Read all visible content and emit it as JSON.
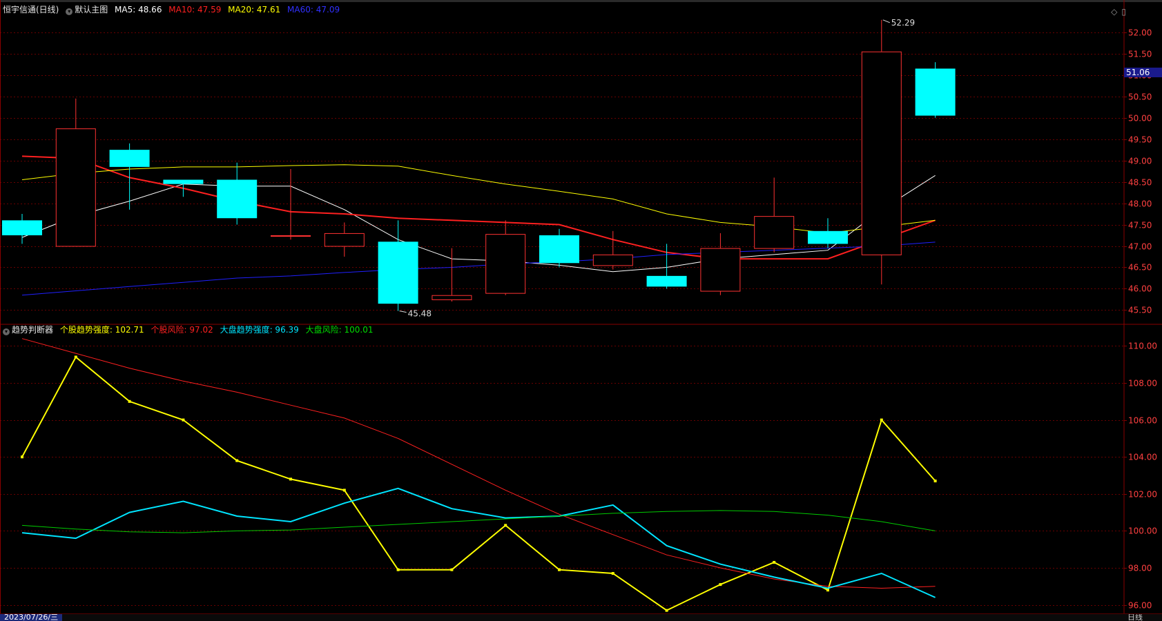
{
  "main_legend": {
    "title": "恒宇信通(日线)",
    "template": "默认主图",
    "ma5": "MA5: 48.66",
    "ma10": "MA10: 47.59",
    "ma20": "MA20: 47.61",
    "ma60": "MA60: 47.09"
  },
  "sub_legend": {
    "title": "趋势判断器",
    "s1": "个股趋势强度: 102.71",
    "s2": "个股风险: 97.02",
    "s3": "大盘趋势强度: 96.39",
    "s4": "大盘风险: 100.01"
  },
  "status": {
    "date": "2023/07/26/三",
    "period": "日线"
  },
  "toolbar": {
    "icons": [
      "diamond-icon",
      "window-icon"
    ]
  },
  "colors": {
    "up": "#ff3232",
    "down": "#00ffff",
    "ma5": "#ffffff",
    "ma10": "#ff2020",
    "ma20": "#ffff00",
    "ma60": "#2020ff",
    "grid": "#6a0000"
  },
  "chart_data": [
    {
      "type": "candlestick",
      "ylim": [
        45.2,
        52.4
      ],
      "yticks": [
        "45.50",
        "46.00",
        "46.50",
        "47.00",
        "47.50",
        "48.00",
        "48.50",
        "49.00",
        "49.50",
        "50.00",
        "50.50",
        "51.00",
        "51.50",
        "52.00"
      ],
      "last_price_label": "51.06",
      "high_label": "52.29",
      "low_label": "45.48",
      "candles": [
        {
          "o": 47.6,
          "c": 47.25,
          "h": 47.75,
          "l": 47.05
        },
        {
          "o": 47.0,
          "c": 49.75,
          "h": 50.45,
          "l": 47.0
        },
        {
          "o": 49.25,
          "c": 48.85,
          "h": 49.4,
          "l": 47.85
        },
        {
          "o": 48.55,
          "c": 48.45,
          "h": 48.55,
          "l": 48.15
        },
        {
          "o": 48.55,
          "c": 47.65,
          "h": 48.95,
          "l": 47.5
        },
        {
          "o": 47.25,
          "c": 47.25,
          "h": 48.8,
          "l": 47.15
        },
        {
          "o": 47.0,
          "c": 47.3,
          "h": 47.55,
          "l": 46.75
        },
        {
          "o": 47.1,
          "c": 45.65,
          "h": 47.6,
          "l": 45.48
        },
        {
          "o": 45.75,
          "c": 45.85,
          "h": 46.95,
          "l": 45.7
        },
        {
          "o": 45.9,
          "c": 47.28,
          "h": 47.6,
          "l": 45.85
        },
        {
          "o": 47.25,
          "c": 46.6,
          "h": 47.4,
          "l": 46.5
        },
        {
          "o": 46.55,
          "c": 46.8,
          "h": 47.35,
          "l": 46.45
        },
        {
          "o": 46.3,
          "c": 46.05,
          "h": 47.05,
          "l": 46.0
        },
        {
          "o": 45.95,
          "c": 46.95,
          "h": 47.3,
          "l": 45.85
        },
        {
          "o": 46.95,
          "c": 47.7,
          "h": 48.6,
          "l": 46.85
        },
        {
          "o": 47.35,
          "c": 47.05,
          "h": 47.65,
          "l": 46.95
        },
        {
          "o": 46.8,
          "c": 51.55,
          "h": 52.29,
          "l": 46.1
        },
        {
          "o": 51.15,
          "c": 50.05,
          "h": 51.3,
          "l": 50.0
        }
      ],
      "series": [
        {
          "name": "MA5",
          "values": [
            47.2,
            47.7,
            48.05,
            48.45,
            48.4,
            48.4,
            47.85,
            47.15,
            46.7,
            46.65,
            46.55,
            46.4,
            46.5,
            46.7,
            46.8,
            46.9,
            47.85,
            48.65
          ]
        },
        {
          "name": "MA10",
          "values": [
            49.1,
            49.05,
            48.6,
            48.35,
            48.05,
            47.8,
            47.75,
            47.65,
            47.6,
            47.55,
            47.5,
            47.15,
            46.85,
            46.7,
            46.7,
            46.7,
            47.15,
            47.6
          ]
        },
        {
          "name": "MA20",
          "values": [
            48.55,
            48.7,
            48.8,
            48.85,
            48.85,
            48.88,
            48.9,
            48.87,
            48.65,
            48.45,
            48.28,
            48.1,
            47.75,
            47.55,
            47.45,
            47.3,
            47.45,
            47.6
          ]
        },
        {
          "name": "MA60",
          "values": [
            45.85,
            45.95,
            46.05,
            46.15,
            46.25,
            46.3,
            46.38,
            46.45,
            46.5,
            46.58,
            46.63,
            46.7,
            46.8,
            46.85,
            46.9,
            46.95,
            47.0,
            47.09
          ]
        }
      ]
    },
    {
      "type": "line",
      "ylim": [
        95.5,
        110.5
      ],
      "yticks": [
        "96.00",
        "98.00",
        "100.00",
        "102.00",
        "104.00",
        "106.00",
        "108.00",
        "110.00"
      ],
      "series": [
        {
          "name": "个股趋势强度",
          "values": [
            104.0,
            109.4,
            107.0,
            106.0,
            103.8,
            102.8,
            102.2,
            97.9,
            97.9,
            100.3,
            97.9,
            97.7,
            95.7,
            97.1,
            98.3,
            96.8,
            106.0,
            102.7
          ]
        },
        {
          "name": "个股风险",
          "values": [
            110.4,
            109.6,
            108.8,
            108.1,
            107.5,
            106.8,
            106.1,
            105.0,
            103.6,
            102.2,
            100.9,
            99.8,
            98.7,
            98.0,
            97.4,
            97.0,
            96.9,
            97.0
          ]
        },
        {
          "name": "大盘趋势强度",
          "values": [
            99.9,
            99.6,
            101.0,
            101.6,
            100.8,
            100.5,
            101.5,
            102.3,
            101.2,
            100.7,
            100.8,
            101.4,
            99.2,
            98.2,
            97.5,
            96.9,
            97.7,
            96.4
          ]
        },
        {
          "name": "大盘风险",
          "values": [
            100.3,
            100.1,
            99.95,
            99.9,
            100.0,
            100.05,
            100.2,
            100.35,
            100.5,
            100.65,
            100.8,
            100.95,
            101.05,
            101.1,
            101.05,
            100.85,
            100.5,
            100.0
          ]
        }
      ]
    }
  ]
}
